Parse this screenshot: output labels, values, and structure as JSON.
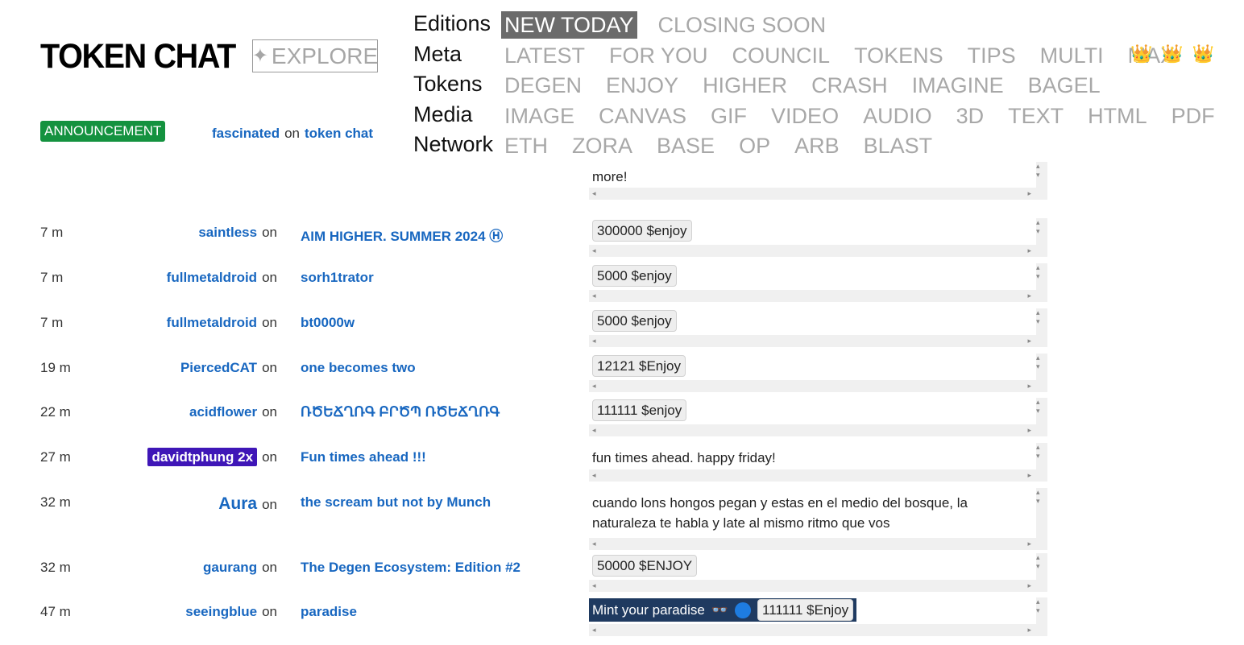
{
  "brand": "TOKEN CHAT",
  "explore": {
    "label": "EXPLORE",
    "icon": "sparkles-icon"
  },
  "nav": {
    "editions": {
      "label": "Editions",
      "items": [
        "NEW TODAY",
        "CLOSING SOON"
      ],
      "active": "NEW TODAY"
    },
    "meta": {
      "label": "Meta",
      "items": [
        "LATEST",
        "FOR YOU",
        "COUNCIL",
        "TOKENS",
        "TIPS",
        "MULTI",
        "MAX"
      ]
    },
    "tokens": {
      "label": "Tokens",
      "items": [
        "DEGEN",
        "ENJOY",
        "HIGHER",
        "CRASH",
        "IMAGINE",
        "BAGEL"
      ]
    },
    "media": {
      "label": "Media",
      "items": [
        "IMAGE",
        "CANVAS",
        "GIF",
        "VIDEO",
        "AUDIO",
        "3D",
        "TEXT",
        "HTML",
        "PDF"
      ]
    },
    "network": {
      "label": "Network",
      "items": [
        "ETH",
        "ZORA",
        "BASE",
        "OP",
        "ARB",
        "BLAST"
      ]
    },
    "crowns": [
      "👑",
      "👑",
      "👑"
    ]
  },
  "announcement": {
    "badge": "ANNOUNCEMENT",
    "user": "fascinated",
    "on": "on",
    "title": "token chat",
    "message": "more!"
  },
  "feed": [
    {
      "time": "7 m",
      "user": "saintless",
      "title": "AIM HIGHER. SUMMER 2024 Ⓗ",
      "message": "300000 $enjoy",
      "chip": true
    },
    {
      "time": "7 m",
      "user": "fullmetaldroid",
      "title": "sorh1trator",
      "message": "5000 $enjoy",
      "chip": true
    },
    {
      "time": "7 m",
      "user": "fullmetaldroid",
      "title": "bt0000w",
      "message": "5000 $enjoy",
      "chip": true
    },
    {
      "time": "19 m",
      "user": "PiercedCAT",
      "title": "one becomes two",
      "message": "12121 $Enjoy",
      "chip": true
    },
    {
      "time": "22 m",
      "user": "acidflower",
      "title": "ՌԾԵՃՂՌԳ ԲՐԾՊ ՌԾԵՃՂՌԳ",
      "message": "111111 $enjoy",
      "chip": true
    },
    {
      "time": "27 m",
      "user": "davidtphung 2x",
      "title": "Fun times ahead !!!",
      "message": "fun times ahead. happy friday!",
      "chip": false,
      "pill": true
    },
    {
      "time": "32 m",
      "user": "Aura",
      "title": "the scream but not by Munch",
      "message": "cuando lons hongos pegan y estas en el medio del bosque, la naturaleza te habla y late al mismo ritmo que vos",
      "chip": false
    },
    {
      "time": "32 m",
      "user": "gaurang",
      "title": "The Degen Ecosystem: Edition #2",
      "message": "50000 $ENJOY",
      "chip": true
    },
    {
      "time": "47 m",
      "user": "seeingblue",
      "title": "paradise",
      "message": "Mint your paradise",
      "mint_emoji": "👓",
      "mint_chip": "111111 $Enjoy",
      "chip": false
    }
  ],
  "on_word": "on"
}
